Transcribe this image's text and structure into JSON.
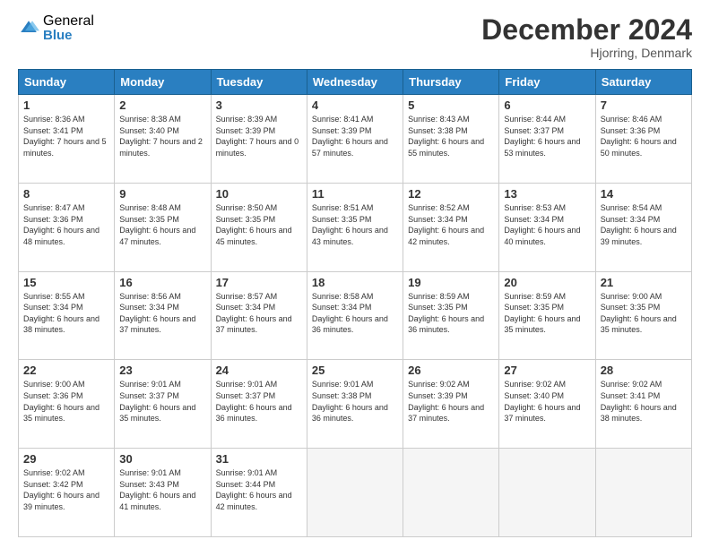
{
  "logo": {
    "general": "General",
    "blue": "Blue"
  },
  "header": {
    "month": "December 2024",
    "location": "Hjorring, Denmark"
  },
  "weekdays": [
    "Sunday",
    "Monday",
    "Tuesday",
    "Wednesday",
    "Thursday",
    "Friday",
    "Saturday"
  ],
  "weeks": [
    [
      {
        "day": 1,
        "sunrise": "8:36 AM",
        "sunset": "3:41 PM",
        "daylight": "7 hours and 5 minutes."
      },
      {
        "day": 2,
        "sunrise": "8:38 AM",
        "sunset": "3:40 PM",
        "daylight": "7 hours and 2 minutes."
      },
      {
        "day": 3,
        "sunrise": "8:39 AM",
        "sunset": "3:39 PM",
        "daylight": "7 hours and 0 minutes."
      },
      {
        "day": 4,
        "sunrise": "8:41 AM",
        "sunset": "3:39 PM",
        "daylight": "6 hours and 57 minutes."
      },
      {
        "day": 5,
        "sunrise": "8:43 AM",
        "sunset": "3:38 PM",
        "daylight": "6 hours and 55 minutes."
      },
      {
        "day": 6,
        "sunrise": "8:44 AM",
        "sunset": "3:37 PM",
        "daylight": "6 hours and 53 minutes."
      },
      {
        "day": 7,
        "sunrise": "8:46 AM",
        "sunset": "3:36 PM",
        "daylight": "6 hours and 50 minutes."
      }
    ],
    [
      {
        "day": 8,
        "sunrise": "8:47 AM",
        "sunset": "3:36 PM",
        "daylight": "6 hours and 48 minutes."
      },
      {
        "day": 9,
        "sunrise": "8:48 AM",
        "sunset": "3:35 PM",
        "daylight": "6 hours and 47 minutes."
      },
      {
        "day": 10,
        "sunrise": "8:50 AM",
        "sunset": "3:35 PM",
        "daylight": "6 hours and 45 minutes."
      },
      {
        "day": 11,
        "sunrise": "8:51 AM",
        "sunset": "3:35 PM",
        "daylight": "6 hours and 43 minutes."
      },
      {
        "day": 12,
        "sunrise": "8:52 AM",
        "sunset": "3:34 PM",
        "daylight": "6 hours and 42 minutes."
      },
      {
        "day": 13,
        "sunrise": "8:53 AM",
        "sunset": "3:34 PM",
        "daylight": "6 hours and 40 minutes."
      },
      {
        "day": 14,
        "sunrise": "8:54 AM",
        "sunset": "3:34 PM",
        "daylight": "6 hours and 39 minutes."
      }
    ],
    [
      {
        "day": 15,
        "sunrise": "8:55 AM",
        "sunset": "3:34 PM",
        "daylight": "6 hours and 38 minutes."
      },
      {
        "day": 16,
        "sunrise": "8:56 AM",
        "sunset": "3:34 PM",
        "daylight": "6 hours and 37 minutes."
      },
      {
        "day": 17,
        "sunrise": "8:57 AM",
        "sunset": "3:34 PM",
        "daylight": "6 hours and 37 minutes."
      },
      {
        "day": 18,
        "sunrise": "8:58 AM",
        "sunset": "3:34 PM",
        "daylight": "6 hours and 36 minutes."
      },
      {
        "day": 19,
        "sunrise": "8:59 AM",
        "sunset": "3:35 PM",
        "daylight": "6 hours and 36 minutes."
      },
      {
        "day": 20,
        "sunrise": "8:59 AM",
        "sunset": "3:35 PM",
        "daylight": "6 hours and 35 minutes."
      },
      {
        "day": 21,
        "sunrise": "9:00 AM",
        "sunset": "3:35 PM",
        "daylight": "6 hours and 35 minutes."
      }
    ],
    [
      {
        "day": 22,
        "sunrise": "9:00 AM",
        "sunset": "3:36 PM",
        "daylight": "6 hours and 35 minutes."
      },
      {
        "day": 23,
        "sunrise": "9:01 AM",
        "sunset": "3:37 PM",
        "daylight": "6 hours and 35 minutes."
      },
      {
        "day": 24,
        "sunrise": "9:01 AM",
        "sunset": "3:37 PM",
        "daylight": "6 hours and 36 minutes."
      },
      {
        "day": 25,
        "sunrise": "9:01 AM",
        "sunset": "3:38 PM",
        "daylight": "6 hours and 36 minutes."
      },
      {
        "day": 26,
        "sunrise": "9:02 AM",
        "sunset": "3:39 PM",
        "daylight": "6 hours and 37 minutes."
      },
      {
        "day": 27,
        "sunrise": "9:02 AM",
        "sunset": "3:40 PM",
        "daylight": "6 hours and 37 minutes."
      },
      {
        "day": 28,
        "sunrise": "9:02 AM",
        "sunset": "3:41 PM",
        "daylight": "6 hours and 38 minutes."
      }
    ],
    [
      {
        "day": 29,
        "sunrise": "9:02 AM",
        "sunset": "3:42 PM",
        "daylight": "6 hours and 39 minutes."
      },
      {
        "day": 30,
        "sunrise": "9:01 AM",
        "sunset": "3:43 PM",
        "daylight": "6 hours and 41 minutes."
      },
      {
        "day": 31,
        "sunrise": "9:01 AM",
        "sunset": "3:44 PM",
        "daylight": "6 hours and 42 minutes."
      },
      null,
      null,
      null,
      null
    ]
  ],
  "labels": {
    "sunrise": "Sunrise:",
    "sunset": "Sunset:",
    "daylight": "Daylight:"
  }
}
